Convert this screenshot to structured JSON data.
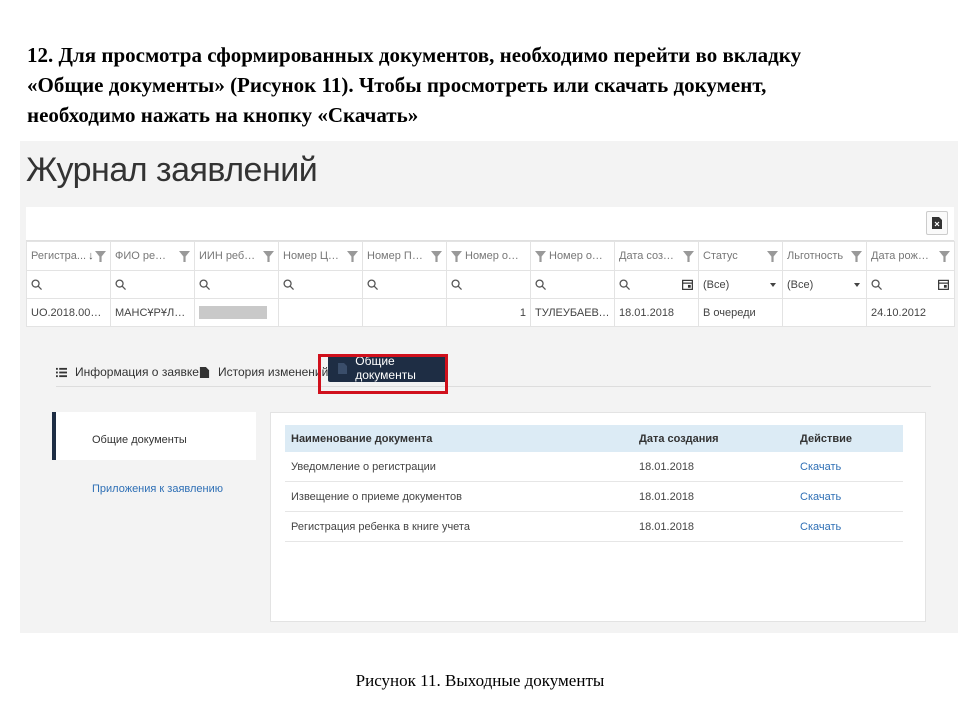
{
  "instruction": {
    "line1": "12. Для просмотра сформированных документов, необходимо перейти во вкладку",
    "line2": "«Общие документы» (Рисунок 11). Чтобы просмотреть или скачать документ,",
    "line3": "необходимо нажать на кнопку «Скачать»"
  },
  "journal": {
    "title": "Журнал заявлений",
    "columns": [
      "Регистра...",
      "ФИО ребе...",
      "ИИН ребе...",
      "Номер ЦОН",
      "Номер ПЕП",
      "Номер оче...",
      "Номер оче...",
      "Дата созда...",
      "Статус",
      "Льготность",
      "Дата рожд..."
    ],
    "filters": {
      "status": "(Все)",
      "benefit": "(Все)"
    },
    "row": {
      "reg": "UO.2018.0000...",
      "fio": "МАНСҰРҰЛЫ ...",
      "queue_num": "1",
      "queue_name": "ТУЛЕУБАЕВА ...",
      "created": "18.01.2018",
      "status": "В очереди",
      "birth": "24.10.2012"
    }
  },
  "tabs": {
    "info": "Информация о заявке",
    "history": "История изменений",
    "docs": "Общие документы"
  },
  "sidebar": {
    "item1": "Общие документы",
    "item2": "Приложения к заявлению"
  },
  "docs_table": {
    "headers": {
      "name": "Наименование документа",
      "date": "Дата создания",
      "action": "Действие"
    },
    "rows": [
      {
        "name": "Уведомление о регистрации",
        "date": "18.01.2018",
        "action": "Скачать"
      },
      {
        "name": "Извещение о приеме документов",
        "date": "18.01.2018",
        "action": "Скачать"
      },
      {
        "name": "Регистрация ребенка в книге учета",
        "date": "18.01.2018",
        "action": "Скачать"
      }
    ]
  },
  "caption": "Рисунок 11. Выходные документы",
  "colors": {
    "accent_tab": "#1e2d44",
    "highlight_border": "#d0101c",
    "link": "#2e6fb5",
    "table_header": "#dcebf5"
  }
}
